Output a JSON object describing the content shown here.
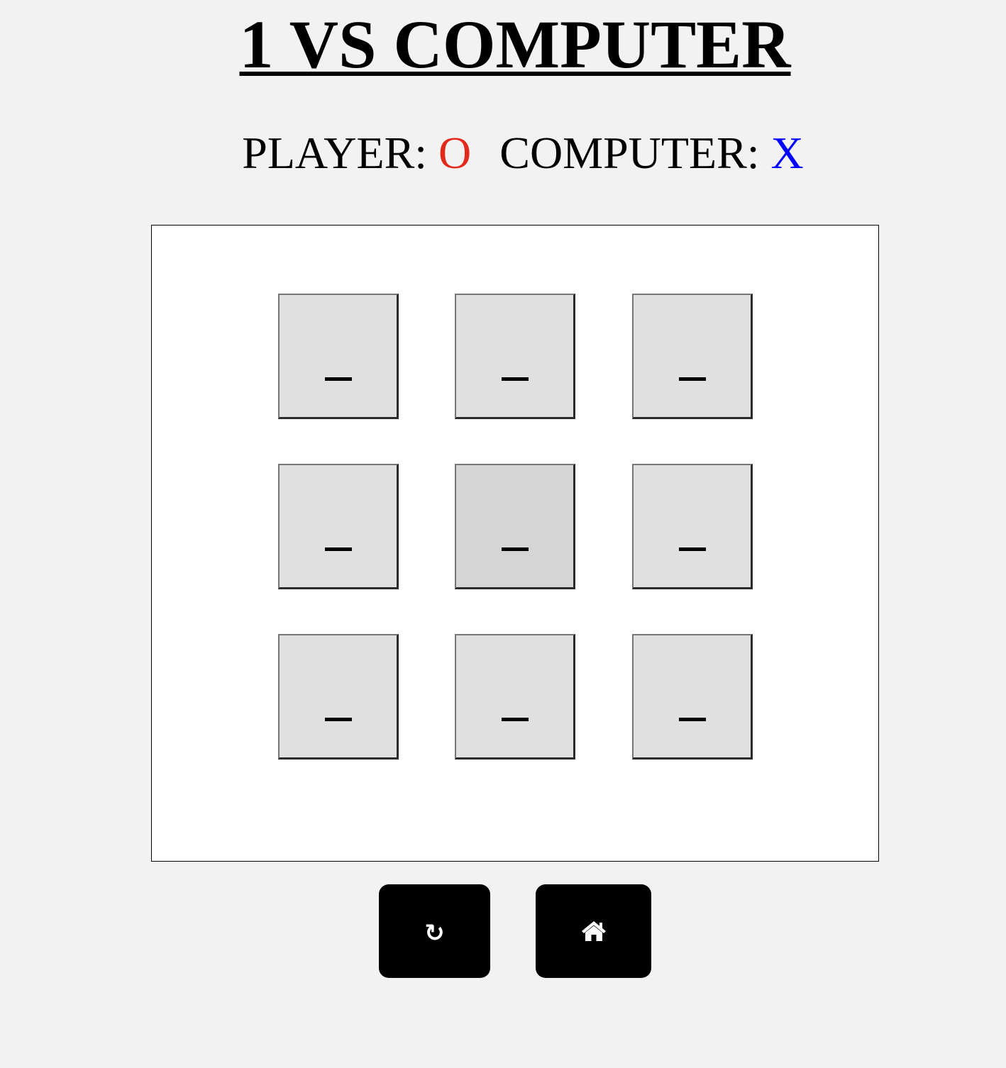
{
  "title": "1 VS COMPUTER",
  "players": {
    "player_label": "PLAYER:",
    "player_mark": "O",
    "player_color": "#e3291c",
    "computer_label": "COMPUTER:",
    "computer_mark": "X",
    "computer_color": "#0000ff"
  },
  "board": {
    "cells": [
      "_",
      "_",
      "_",
      "_",
      "_",
      "_",
      "_",
      "_",
      "_"
    ]
  },
  "controls": {
    "restart_icon": "restart-icon",
    "restart_glyph": "↻",
    "home_icon": "home-icon"
  }
}
